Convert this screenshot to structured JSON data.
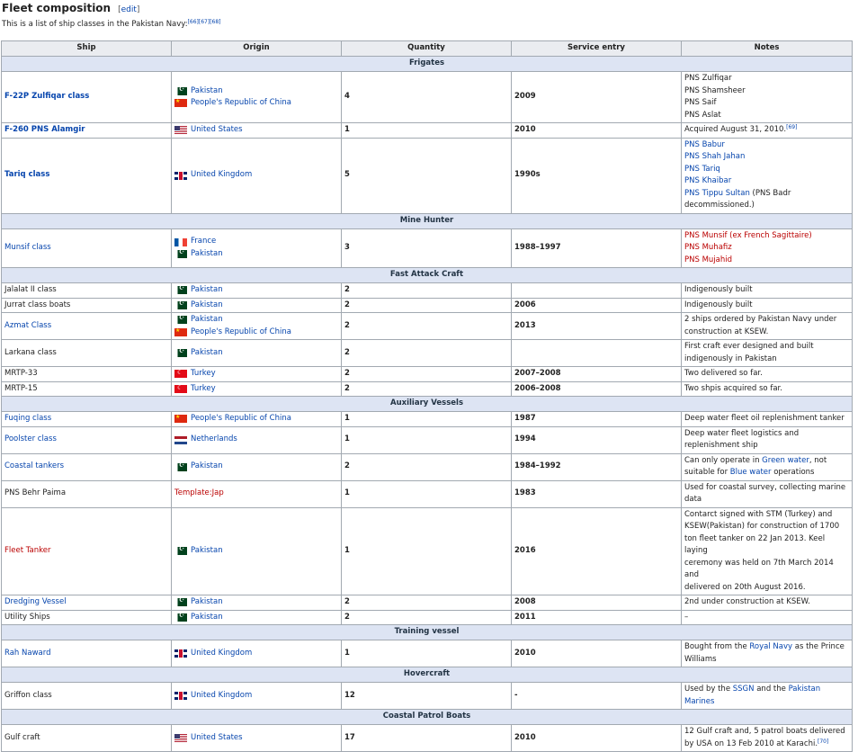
{
  "heading": "Fleet composition",
  "edit_open": "[",
  "edit_label": "edit",
  "edit_close": "]",
  "intro": "This is a list of ship classes in the Pakistan Navy:",
  "intro_refs": "[66][67][68]",
  "columns": [
    "Ship",
    "Origin",
    "Quantity",
    "Service entry",
    "Notes"
  ],
  "sections": [
    {
      "title": "Frigates",
      "rows": [
        {
          "ship": "F-22P Zulfiqar class",
          "ship_style": "bold-link",
          "origin": [
            {
              "flag": "pk",
              "name": "Pakistan"
            },
            {
              "flag": "cn",
              "name": "People's Republic of China"
            }
          ],
          "quantity": "4",
          "service": "2009",
          "notes": [
            [
              {
                "t": "PNS Zulfiqar"
              }
            ],
            [
              {
                "t": "PNS Shamsheer"
              }
            ],
            [
              {
                "t": "PNS Saif"
              }
            ],
            [
              {
                "t": "PNS Aslat"
              }
            ]
          ]
        },
        {
          "ship": "F-260 PNS Alamgir",
          "ship_style": "bold-link",
          "origin": [
            {
              "flag": "us",
              "name": "United States"
            }
          ],
          "quantity": "1",
          "service": "2010",
          "notes": [
            [
              {
                "t": "Acquired August 31, 2010."
              },
              {
                "t": "[69]",
                "s": "sup"
              }
            ]
          ]
        },
        {
          "ship": "Tariq class",
          "ship_style": "bold-link",
          "origin": [
            {
              "flag": "uk",
              "name": "United Kingdom"
            }
          ],
          "quantity": "5",
          "service": "1990s",
          "notes": [
            [
              {
                "t": "PNS Babur",
                "s": "link"
              }
            ],
            [
              {
                "t": "PNS Shah Jahan",
                "s": "link"
              }
            ],
            [
              {
                "t": "PNS Tariq",
                "s": "link"
              }
            ],
            [
              {
                "t": "PNS Khaibar",
                "s": "link"
              }
            ],
            [
              {
                "t": "PNS Tippu Sultan",
                "s": "link"
              },
              {
                "t": " (PNS Badr"
              }
            ],
            [
              {
                "t": "decommissioned.)"
              }
            ]
          ]
        }
      ]
    },
    {
      "title": "Mine Hunter",
      "rows": [
        {
          "ship": "Munsif class",
          "ship_style": "link",
          "origin": [
            {
              "flag": "fr",
              "name": "France"
            },
            {
              "flag": "pk",
              "name": "Pakistan"
            }
          ],
          "quantity": "3",
          "service": "1988–1997",
          "notes": [
            [
              {
                "t": "PNS Munsif (ex French Sagittaire)",
                "s": "red"
              }
            ],
            [
              {
                "t": "PNS Muhafiz",
                "s": "red"
              }
            ],
            [
              {
                "t": "PNS Mujahid",
                "s": "red"
              }
            ]
          ]
        }
      ]
    },
    {
      "title": "Fast Attack Craft",
      "rows": [
        {
          "ship": "Jalalat II class",
          "ship_style": "plain",
          "origin": [
            {
              "flag": "pk",
              "name": "Pakistan"
            }
          ],
          "quantity": "2",
          "service": "",
          "notes": [
            [
              {
                "t": "Indigenously built"
              }
            ]
          ]
        },
        {
          "ship": "Jurrat class boats",
          "ship_style": "plain",
          "origin": [
            {
              "flag": "pk",
              "name": "Pakistan"
            }
          ],
          "quantity": "2",
          "service": "2006",
          "notes": [
            [
              {
                "t": "Indigenously built"
              }
            ]
          ]
        },
        {
          "ship": "Azmat Class",
          "ship_style": "link",
          "origin": [
            {
              "flag": "pk",
              "name": "Pakistan"
            },
            {
              "flag": "cn",
              "name": "People's Republic of China"
            }
          ],
          "quantity": "2",
          "service": "2013",
          "notes": [
            [
              {
                "t": "2 ships ordered by Pakistan Navy under"
              }
            ],
            [
              {
                "t": "construction at KSEW."
              }
            ]
          ]
        },
        {
          "ship": "Larkana class",
          "ship_style": "plain",
          "origin": [
            {
              "flag": "pk",
              "name": "Pakistan"
            }
          ],
          "quantity": "2",
          "service": "",
          "notes": [
            [
              {
                "t": "First craft ever designed and built"
              }
            ],
            [
              {
                "t": "indigenously in Pakistan"
              }
            ]
          ]
        },
        {
          "ship": "MRTP-33",
          "ship_style": "plain",
          "origin": [
            {
              "flag": "tr",
              "name": "Turkey"
            }
          ],
          "quantity": "2",
          "service": "2007–2008",
          "notes": [
            [
              {
                "t": "Two delivered so far."
              }
            ]
          ]
        },
        {
          "ship": "MRTP-15",
          "ship_style": "plain",
          "origin": [
            {
              "flag": "tr",
              "name": "Turkey"
            }
          ],
          "quantity": "2",
          "service": "2006–2008",
          "notes": [
            [
              {
                "t": "Two shpis acquired so far."
              }
            ]
          ]
        }
      ]
    },
    {
      "title": "Auxiliary Vessels",
      "rows": [
        {
          "ship": "Fuqing class",
          "ship_style": "link",
          "origin": [
            {
              "flag": "cn",
              "name": "People's Republic of China"
            }
          ],
          "quantity": "1",
          "service": "1987",
          "notes": [
            [
              {
                "t": "Deep water fleet oil replenishment tanker"
              }
            ]
          ]
        },
        {
          "ship": "Poolster class",
          "ship_style": "link",
          "origin": [
            {
              "flag": "nl",
              "name": "Netherlands"
            }
          ],
          "quantity": "1",
          "service": "1994",
          "notes": [
            [
              {
                "t": "Deep water fleet logistics and"
              }
            ],
            [
              {
                "t": "replenishment ship"
              }
            ]
          ]
        },
        {
          "ship": "Coastal tankers",
          "ship_style": "link",
          "origin": [
            {
              "flag": "pk",
              "name": "Pakistan"
            }
          ],
          "quantity": "2",
          "service": "1984–1992",
          "notes": [
            [
              {
                "t": "Can only operate in "
              },
              {
                "t": "Green water",
                "s": "link"
              },
              {
                "t": ", not"
              }
            ],
            [
              {
                "t": "suitable for "
              },
              {
                "t": "Blue water",
                "s": "link"
              },
              {
                "t": " operations"
              }
            ]
          ]
        },
        {
          "ship": "PNS Behr Paima",
          "ship_style": "plain",
          "origin": [
            {
              "flag": "",
              "name": "Template:Jap",
              "style": "red"
            }
          ],
          "quantity": "1",
          "service": "1983",
          "notes": [
            [
              {
                "t": "Used for coastal survey, collecting marine"
              }
            ],
            [
              {
                "t": "data"
              }
            ]
          ]
        },
        {
          "ship": "Fleet Tanker",
          "ship_style": "red",
          "origin": [
            {
              "flag": "pk",
              "name": "Pakistan"
            }
          ],
          "quantity": "1",
          "service": "2016",
          "notes": [
            [
              {
                "t": "Contarct signed with STM (Turkey) and"
              }
            ],
            [
              {
                "t": "KSEW(Pakistan) for construction of 1700"
              }
            ],
            [
              {
                "t": "ton fleet tanker on 22 Jan 2013. Keel laying"
              }
            ],
            [
              {
                "t": "ceremony was held on 7th March 2014 and"
              }
            ],
            [
              {
                "t": "delivered on 20th August 2016."
              }
            ]
          ]
        },
        {
          "ship": "Dredging Vessel",
          "ship_style": "link",
          "origin": [
            {
              "flag": "pk",
              "name": "Pakistan"
            }
          ],
          "quantity": "2",
          "service": "2008",
          "notes": [
            [
              {
                "t": "2nd under construction at KSEW."
              }
            ]
          ]
        },
        {
          "ship": "Utility Ships",
          "ship_style": "plain",
          "origin": [
            {
              "flag": "pk",
              "name": "Pakistan"
            }
          ],
          "quantity": "2",
          "service": "2011",
          "notes": [
            [
              {
                "t": "–"
              }
            ]
          ]
        }
      ]
    },
    {
      "title": "Training vessel",
      "rows": [
        {
          "ship": "Rah Naward",
          "ship_style": "link",
          "origin": [
            {
              "flag": "uk",
              "name": "United Kingdom"
            }
          ],
          "quantity": "1",
          "service": "2010",
          "notes": [
            [
              {
                "t": "Bought from the "
              },
              {
                "t": "Royal Navy",
                "s": "link"
              },
              {
                "t": " as the Prince"
              }
            ],
            [
              {
                "t": "Williams"
              }
            ]
          ]
        }
      ]
    },
    {
      "title": "Hovercraft",
      "rows": [
        {
          "ship": "Griffon class",
          "ship_style": "plain",
          "origin": [
            {
              "flag": "uk",
              "name": "United Kingdom"
            }
          ],
          "quantity": "12",
          "service": "-",
          "notes": [
            [
              {
                "t": "Used by the "
              },
              {
                "t": "SSGN",
                "s": "link"
              },
              {
                "t": " and the "
              },
              {
                "t": "Pakistan",
                "s": "link"
              }
            ],
            [
              {
                "t": "Marines",
                "s": "link"
              }
            ]
          ]
        }
      ]
    },
    {
      "title": "Coastal Patrol Boats",
      "rows": [
        {
          "ship": "Gulf craft",
          "ship_style": "plain",
          "origin": [
            {
              "flag": "us",
              "name": "United States"
            }
          ],
          "quantity": "17",
          "service": "2010",
          "notes": [
            [
              {
                "t": "12 Gulf craft and, 5 patrol boats delivered"
              }
            ],
            [
              {
                "t": "by USA on 13 Feb 2010 at Karachi."
              },
              {
                "t": "[70]",
                "s": "sup"
              }
            ]
          ]
        }
      ]
    }
  ]
}
